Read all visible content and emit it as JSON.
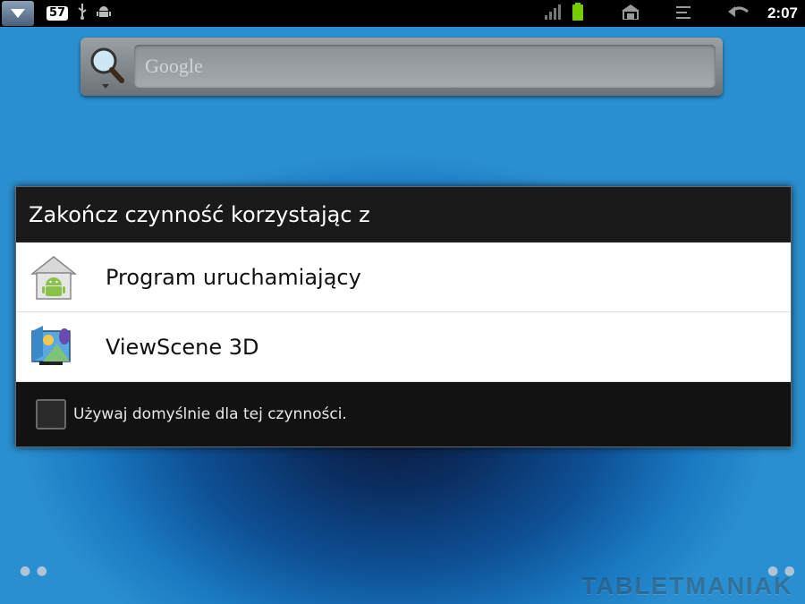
{
  "status_bar": {
    "notification_count": "57",
    "time": "2:07",
    "left_icons": [
      "notification-dropdown-icon",
      "usb-icon",
      "android-debug-icon"
    ],
    "right_icons": [
      "signal-icon",
      "battery-icon",
      "home-icon",
      "menu-icon",
      "back-icon"
    ]
  },
  "search": {
    "placeholder": "Google",
    "icon": "magnifier-icon"
  },
  "dialog": {
    "title": "Zakończ czynność korzystając z",
    "items": [
      {
        "label": "Program uruchamiający",
        "icon": "launcher-home-icon"
      },
      {
        "label": "ViewScene 3D",
        "icon": "viewscene-icon"
      }
    ],
    "default_checkbox_label": "Używaj domyślnie dla tej czynności.",
    "default_checked": false
  },
  "watermark": "TABLETMANIAK",
  "colors": {
    "accent": "#1a78c0",
    "dialog_bg": "#111111",
    "item_bg": "#ffffff",
    "android_green": "#8bc34a"
  }
}
